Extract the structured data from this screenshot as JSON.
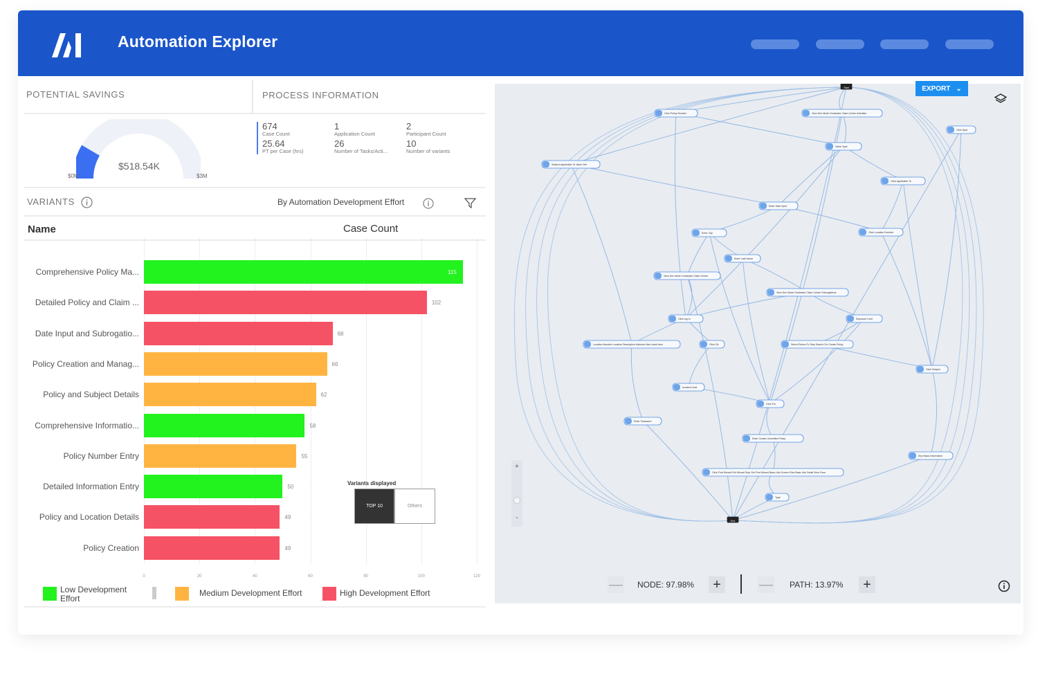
{
  "app": {
    "logo": "AI",
    "title": "Automation Explorer"
  },
  "savings": {
    "title": "POTENTIAL SAVINGS",
    "value": "$518.54K",
    "min_label": "$0M",
    "max_label": "$3M",
    "fraction": 0.17
  },
  "process": {
    "title": "PROCESS INFORMATION",
    "stats": [
      {
        "value": "674",
        "caption": "Case Count"
      },
      {
        "value": "1",
        "caption": "Application Count"
      },
      {
        "value": "2",
        "caption": "Participant Count"
      },
      {
        "value": "25.64",
        "caption": "PT per Case (hrs)"
      },
      {
        "value": "26",
        "caption": "Number of Tasks/Acti..."
      },
      {
        "value": "10",
        "caption": "Number of variants"
      }
    ]
  },
  "variants": {
    "title": "VARIANTS",
    "info_icon": "info-icon",
    "subtitle": "By Automation Development Effort",
    "filter_icon": "filter-icon",
    "col_name": "Name",
    "col_count": "Case Count"
  },
  "chart_data": {
    "type": "bar",
    "orientation": "horizontal",
    "categories": [
      "Comprehensive Policy Ma...",
      "Detailed Policy and Claim ...",
      "Date Input and Subrogatio...",
      "Policy Creation and Manag...",
      "Policy and Subject Details",
      "Comprehensive Informatio...",
      "Policy Number Entry",
      "Detailed Information Entry",
      "Policy and Location Details",
      "Policy Creation"
    ],
    "values": [
      115,
      102,
      68,
      66,
      62,
      58,
      55,
      50,
      49,
      49
    ],
    "effort": [
      "Low",
      "High",
      "High",
      "Medium",
      "Medium",
      "Low",
      "Medium",
      "Low",
      "High",
      "High"
    ],
    "xlim": [
      0,
      120
    ],
    "xticks": [
      0,
      20,
      40,
      60,
      80,
      100,
      120
    ],
    "colors": {
      "Low": "#22f21d",
      "Medium": "#ffb442",
      "High": "#f65265"
    },
    "legend": [
      {
        "label": "Low Development Effort",
        "effort": "Low"
      },
      {
        "label": "Medium Development Effort",
        "effort": "Medium"
      },
      {
        "label": "High  Development Effort",
        "effort": "High"
      }
    ]
  },
  "variants_displayed": {
    "title": "Variants displayed",
    "top": "TOP 10",
    "others": "Others"
  },
  "graph": {
    "export_label": "EXPORT",
    "nodes": [
      "Start",
      "Click Policy Number",
      "View Dev Mode Guidewire Claim Center Activities",
      "Click Spot",
      "Subject Applicable To Value Veh",
      "Value Type",
      "Click Applicable To",
      "Enter Date Input",
      "Click Location Number",
      "Enter City",
      "Enter Last Name",
      "View Dev Mode Guidewire Claim Center",
      "View Dev Mode Guidewire Claim Center Subrogations",
      "Click log In",
      "Exposure Limit",
      "Location Number Location Description Address Has Listed Item",
      "Click Ok",
      "Select Return To Step Search On Create Policy",
      "Click Subject",
      "Incident Limit",
      "Click Fin",
      "Enter Password",
      "Enter Create Unverified Policy",
      "Enp Basic Information",
      "Click Find Wizard Full Wizard Step Set Find Wizard Basic Info Screen Row Basic Info Detail View Form",
      "Type",
      "End"
    ],
    "node_stat": "NODE: 97.98%",
    "path_stat": "PATH: 13.97%",
    "zoom_in": "+",
    "zoom_out": "-",
    "minus": "—",
    "plus": "+"
  }
}
